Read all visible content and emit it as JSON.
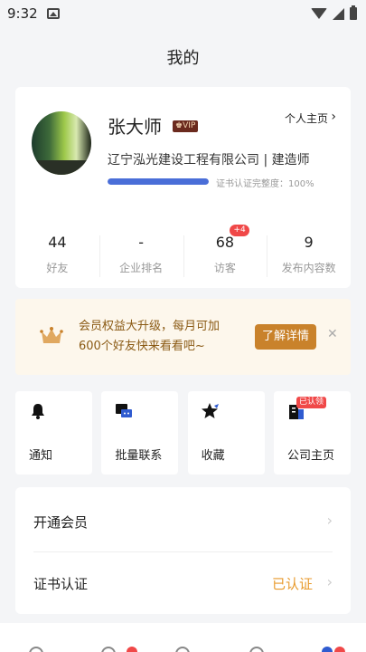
{
  "status_bar": {
    "time": "9:32"
  },
  "header": {
    "title": "我的"
  },
  "profile": {
    "name": "张大师",
    "vip_label": "VIP",
    "homepage_link": "个人主页",
    "company": "辽宁泓光建设工程有限公司 | 建造师",
    "certificate_progress_text": "证书认证完整度：100%",
    "certificate_progress": 1.0
  },
  "stats": [
    {
      "value": "44",
      "label": "好友"
    },
    {
      "value": "-",
      "label": "企业排名"
    },
    {
      "value": "68",
      "label": "访客",
      "badge": "+4"
    },
    {
      "value": "9",
      "label": "发布内容数"
    }
  ],
  "promo": {
    "line1": "会员权益大升级，每月可加",
    "line2": "600个好友快来看看吧~",
    "button": "了解详情"
  },
  "quick_actions": [
    {
      "label": "通知",
      "icon": "bell-icon"
    },
    {
      "label": "批量联系",
      "icon": "chat-icon"
    },
    {
      "label": "收藏",
      "icon": "star-icon"
    },
    {
      "label": "公司主页",
      "icon": "building-icon",
      "badge": "已认领"
    }
  ],
  "menu": [
    {
      "label": "开通会员",
      "value": ""
    },
    {
      "label": "证书认证",
      "value": "已认证"
    }
  ],
  "colors": {
    "accent_blue": "#4a6ed8",
    "promo_brown": "#c9822b",
    "status_orange": "#e89a2c",
    "badge_red": "#f04848"
  }
}
